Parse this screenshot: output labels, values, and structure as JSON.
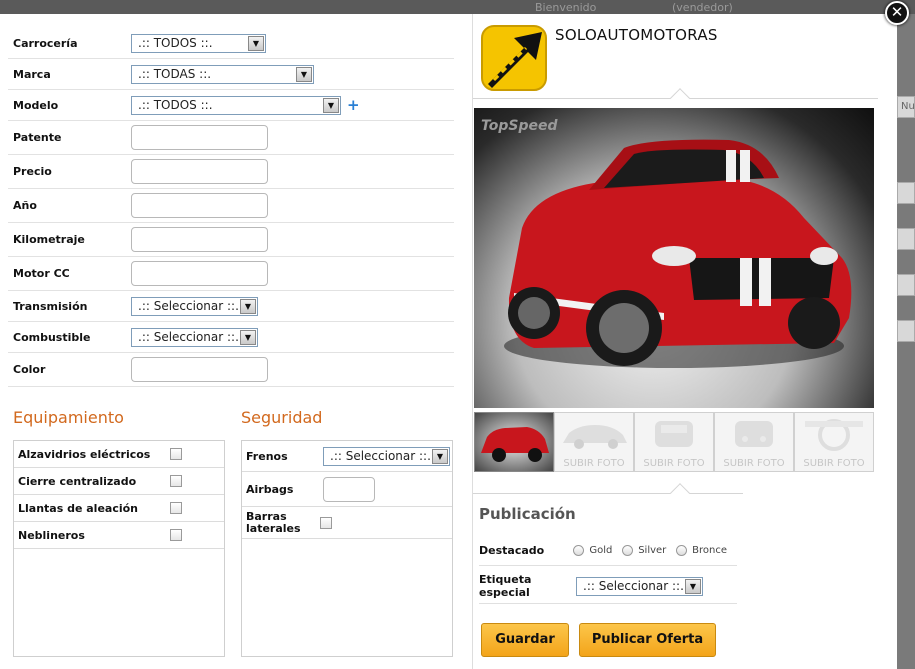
{
  "backdrop": {
    "welcome": "Bienvenido",
    "user": "(vendedor)",
    "right_edge_text": "Nu"
  },
  "form": {
    "carroceria": {
      "label": "Carrocería",
      "value": ".:: TODOS ::."
    },
    "marca": {
      "label": "Marca",
      "value": ".:: TODAS ::."
    },
    "modelo": {
      "label": "Modelo",
      "value": ".:: TODOS ::."
    },
    "patente": {
      "label": "Patente"
    },
    "precio": {
      "label": "Precio"
    },
    "anio": {
      "label": "Año"
    },
    "kilometraje": {
      "label": "Kilometraje"
    },
    "motor": {
      "label": "Motor CC"
    },
    "transmision": {
      "label": "Transmisión",
      "value": ".:: Seleccionar ::."
    },
    "combustible": {
      "label": "Combustible",
      "value": ".:: Seleccionar ::."
    },
    "color": {
      "label": "Color"
    }
  },
  "equipamiento": {
    "title": "Equipamiento",
    "items": [
      "Alzavidrios eléctricos",
      "Cierre centralizado",
      "Llantas de aleación",
      "Neblineros"
    ]
  },
  "seguridad": {
    "title": "Seguridad",
    "frenos": {
      "label": "Frenos",
      "value": ".:: Seleccionar ::."
    },
    "airbags": {
      "label": "Airbags"
    },
    "barras": {
      "label": "Barras laterales"
    }
  },
  "dealer": {
    "name": "SOLOAUTOMOTORAS"
  },
  "photo": {
    "watermark": "TopSpeed"
  },
  "thumbnails": {
    "upload_label": "SUBIR FOTO"
  },
  "publicacion": {
    "title": "Publicación",
    "destacado": {
      "label": "Destacado",
      "options": [
        "Gold",
        "Silver",
        "Bronce"
      ]
    },
    "etiqueta": {
      "label": "Etiqueta especial",
      "value": ".:: Seleccionar ::."
    }
  },
  "buttons": {
    "guardar": "Guardar",
    "publicar": "Publicar Oferta"
  },
  "colors": {
    "accent": "#f7b52b",
    "section_title": "#d2691e",
    "logo_yellow": "#f5c400"
  },
  "icons": {
    "close": "close-icon",
    "add": "plus-icon",
    "dropdown": "chevron-down-icon"
  }
}
